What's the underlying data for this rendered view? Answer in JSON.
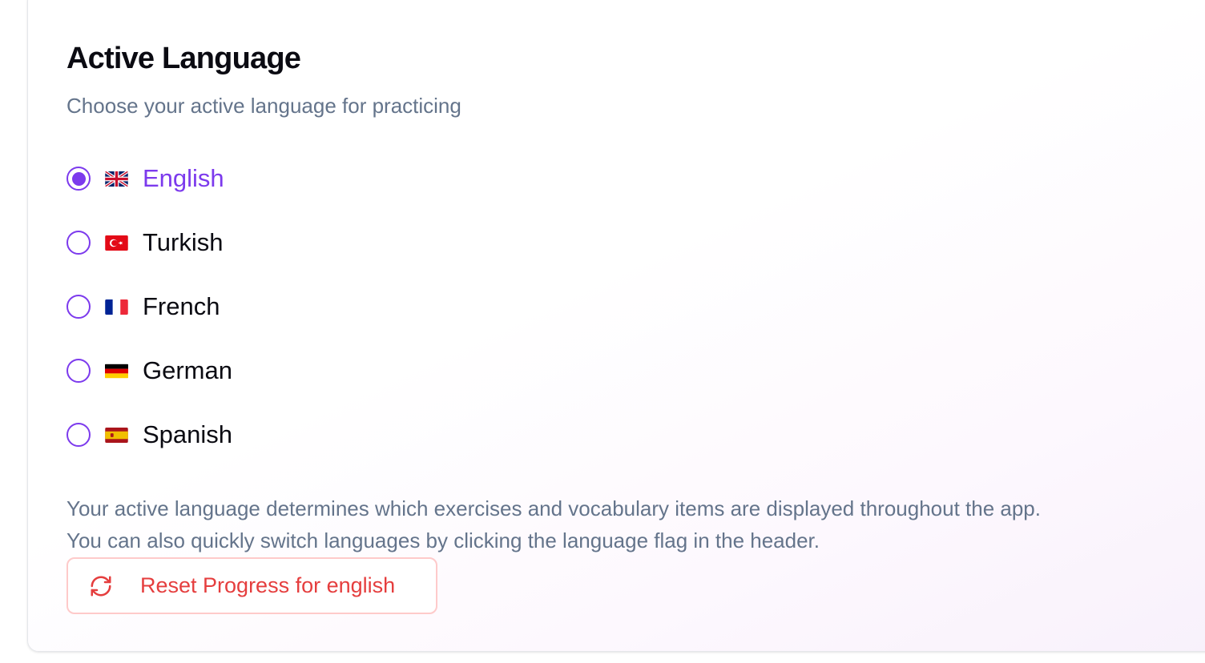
{
  "section": {
    "title": "Active Language",
    "subtitle": "Choose your active language for practicing"
  },
  "languages": [
    {
      "label": "English",
      "flag": "uk-flag-icon",
      "selected": true
    },
    {
      "label": "Turkish",
      "flag": "turkey-flag-icon",
      "selected": false
    },
    {
      "label": "French",
      "flag": "france-flag-icon",
      "selected": false
    },
    {
      "label": "German",
      "flag": "germany-flag-icon",
      "selected": false
    },
    {
      "label": "Spanish",
      "flag": "spain-flag-icon",
      "selected": false
    }
  ],
  "help": {
    "line1": "Your active language determines which exercises and vocabulary items are displayed throughout the app.",
    "line2": "You can also quickly switch languages by clicking the language flag in the header."
  },
  "reset": {
    "label": "Reset Progress for english",
    "icon": "refresh-icon"
  },
  "colors": {
    "accent": "#7c3aed",
    "danger": "#e53e3e",
    "muted_text": "#64748b"
  }
}
